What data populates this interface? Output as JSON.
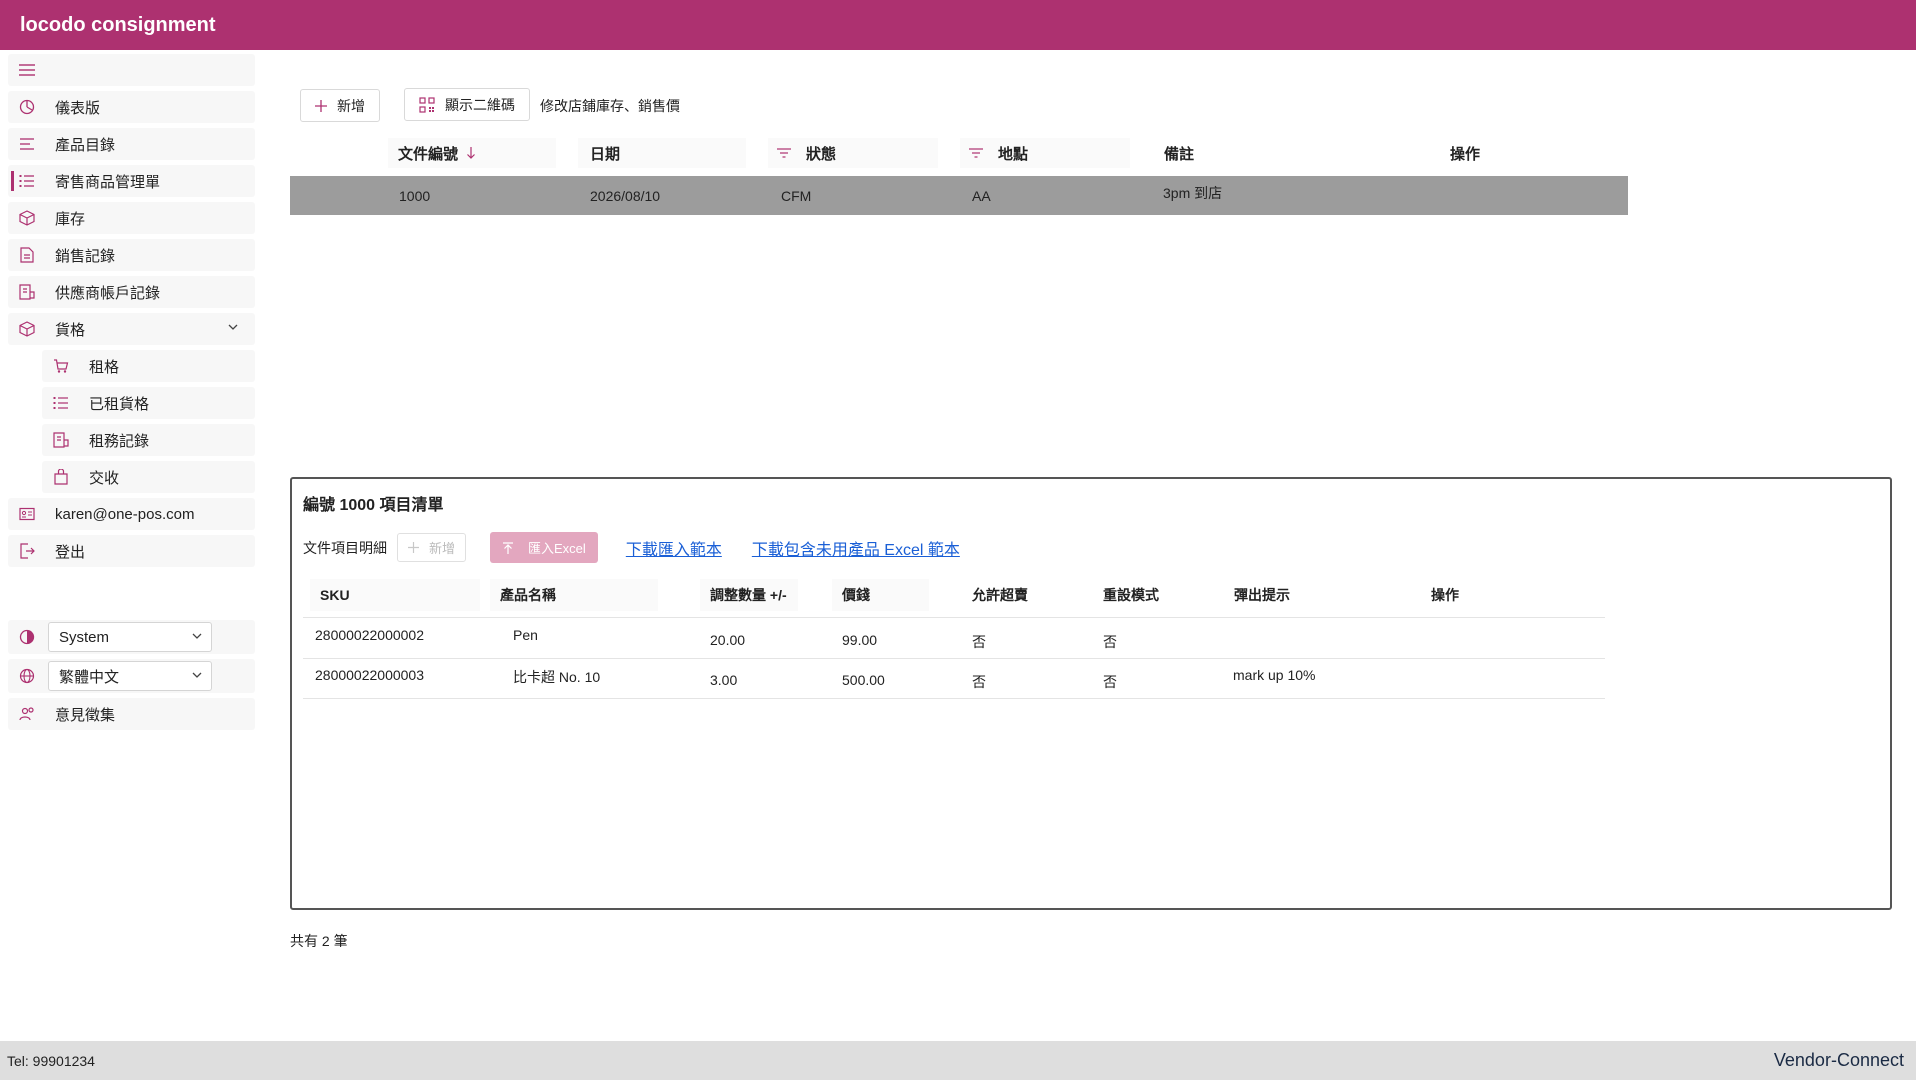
{
  "app": {
    "title": "locodo consignment"
  },
  "sidebar": {
    "items": [
      {
        "label": "儀表版"
      },
      {
        "label": "產品目錄"
      },
      {
        "label": "寄售商品管理單"
      },
      {
        "label": "庫存"
      },
      {
        "label": "銷售記錄"
      },
      {
        "label": "供應商帳戶記錄"
      },
      {
        "label": "貨格"
      },
      {
        "label": "租格"
      },
      {
        "label": "已租貨格"
      },
      {
        "label": "租務記錄"
      },
      {
        "label": "交收"
      },
      {
        "label": "karen@one-pos.com"
      },
      {
        "label": "登出"
      }
    ],
    "theme_value": "System",
    "language_value": "繁體中文",
    "feedback_label": "意見徵集"
  },
  "toolbar": {
    "add_label": "新增",
    "qr_label": "顯示二維碼",
    "edit_label": "修改店鋪庫存、銷售價"
  },
  "main_table": {
    "columns": [
      "文件編號",
      "日期",
      "狀態",
      "地點",
      "備註",
      "操作"
    ],
    "rows": [
      {
        "doc_no": "1000",
        "date": "2026/08/10",
        "status": "CFM",
        "location": "AA",
        "remark": "3pm 到店"
      }
    ]
  },
  "detail": {
    "title": "編號 1000 項目清單",
    "section_label": "文件項目明細",
    "add_label": "新增",
    "import_label": "匯入Excel",
    "download_template": "下載匯入範本",
    "download_template_full": "下載包含未用產品 Excel 範本",
    "columns": [
      "SKU",
      "產品名稱",
      "調整數量 +/-",
      "價錢",
      "允許超賣",
      "重設模式",
      "彈出提示",
      "操作"
    ],
    "rows": [
      {
        "sku": "28000022000002",
        "name": "Pen",
        "qty": "20.00",
        "price": "99.00",
        "oversell": "否",
        "reset": "否",
        "popup": ""
      },
      {
        "sku": "28000022000003",
        "name": "比卡超 No. 10",
        "qty": "3.00",
        "price": "500.00",
        "oversell": "否",
        "reset": "否",
        "popup": "mark up 10%"
      }
    ]
  },
  "footer": {
    "count_text": "共有 2 筆",
    "tel": "Tel: 99901234",
    "brand_a": "Vendor",
    "brand_sep": "-",
    "brand_b": "Connect"
  },
  "colors": {
    "brand": "#ad3170",
    "selected_row": "#9c9c9c",
    "link": "#1a5fd6"
  }
}
